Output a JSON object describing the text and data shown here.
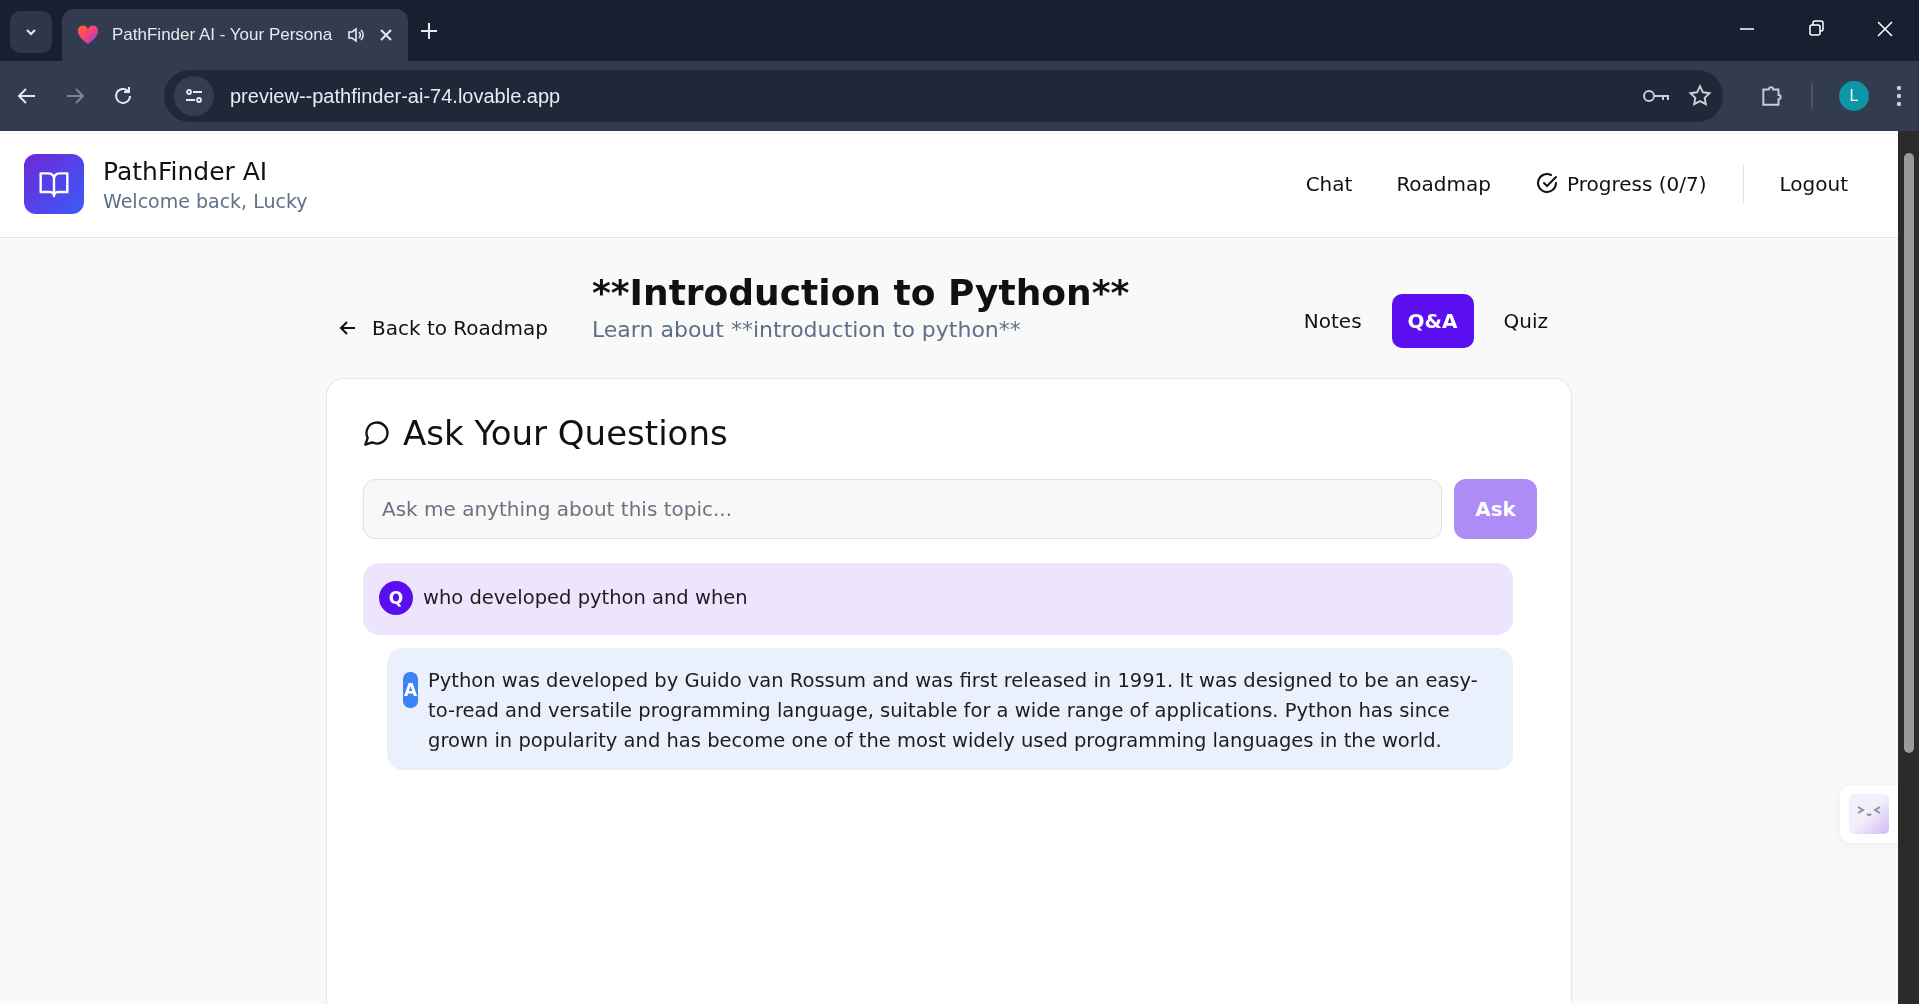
{
  "browser": {
    "tab_title": "PathFinder AI - Your Persona",
    "url": "preview--pathfinder-ai-74.lovable.app",
    "profile_initial": "L"
  },
  "header": {
    "app_name": "PathFinder AI",
    "welcome": "Welcome back, Lucky",
    "nav": [
      {
        "kind": "link",
        "label": "Chat"
      },
      {
        "kind": "link",
        "label": "Roadmap"
      },
      {
        "kind": "progress",
        "label": "Progress (0/7)"
      },
      {
        "kind": "logout",
        "label": "Logout"
      }
    ]
  },
  "lesson": {
    "back_label": "Back to Roadmap",
    "title": "**Introduction to Python**",
    "subtitle": "Learn about **introduction to python**",
    "tabs": [
      {
        "label": "Notes",
        "selected": false
      },
      {
        "label": "Q&A",
        "selected": true
      },
      {
        "label": "Quiz",
        "selected": false
      }
    ]
  },
  "qa": {
    "heading": "Ask Your Questions",
    "input": {
      "placeholder": "Ask me anything about this topic..."
    },
    "ask_button": {
      "label": "Ask",
      "disabled": true
    },
    "messages": [
      {
        "kind": "question",
        "badge": "Q",
        "text": "who developed python and when"
      },
      {
        "kind": "answer",
        "badge": "A",
        "text": "Python was developed by Guido van Rossum and was first released in 1991. It was designed to be an easy-to-read and versatile programming language, suitable for a wide range of applications. Python has since grown in popularity and has become one of the most widely used programming languages in the world."
      }
    ]
  }
}
